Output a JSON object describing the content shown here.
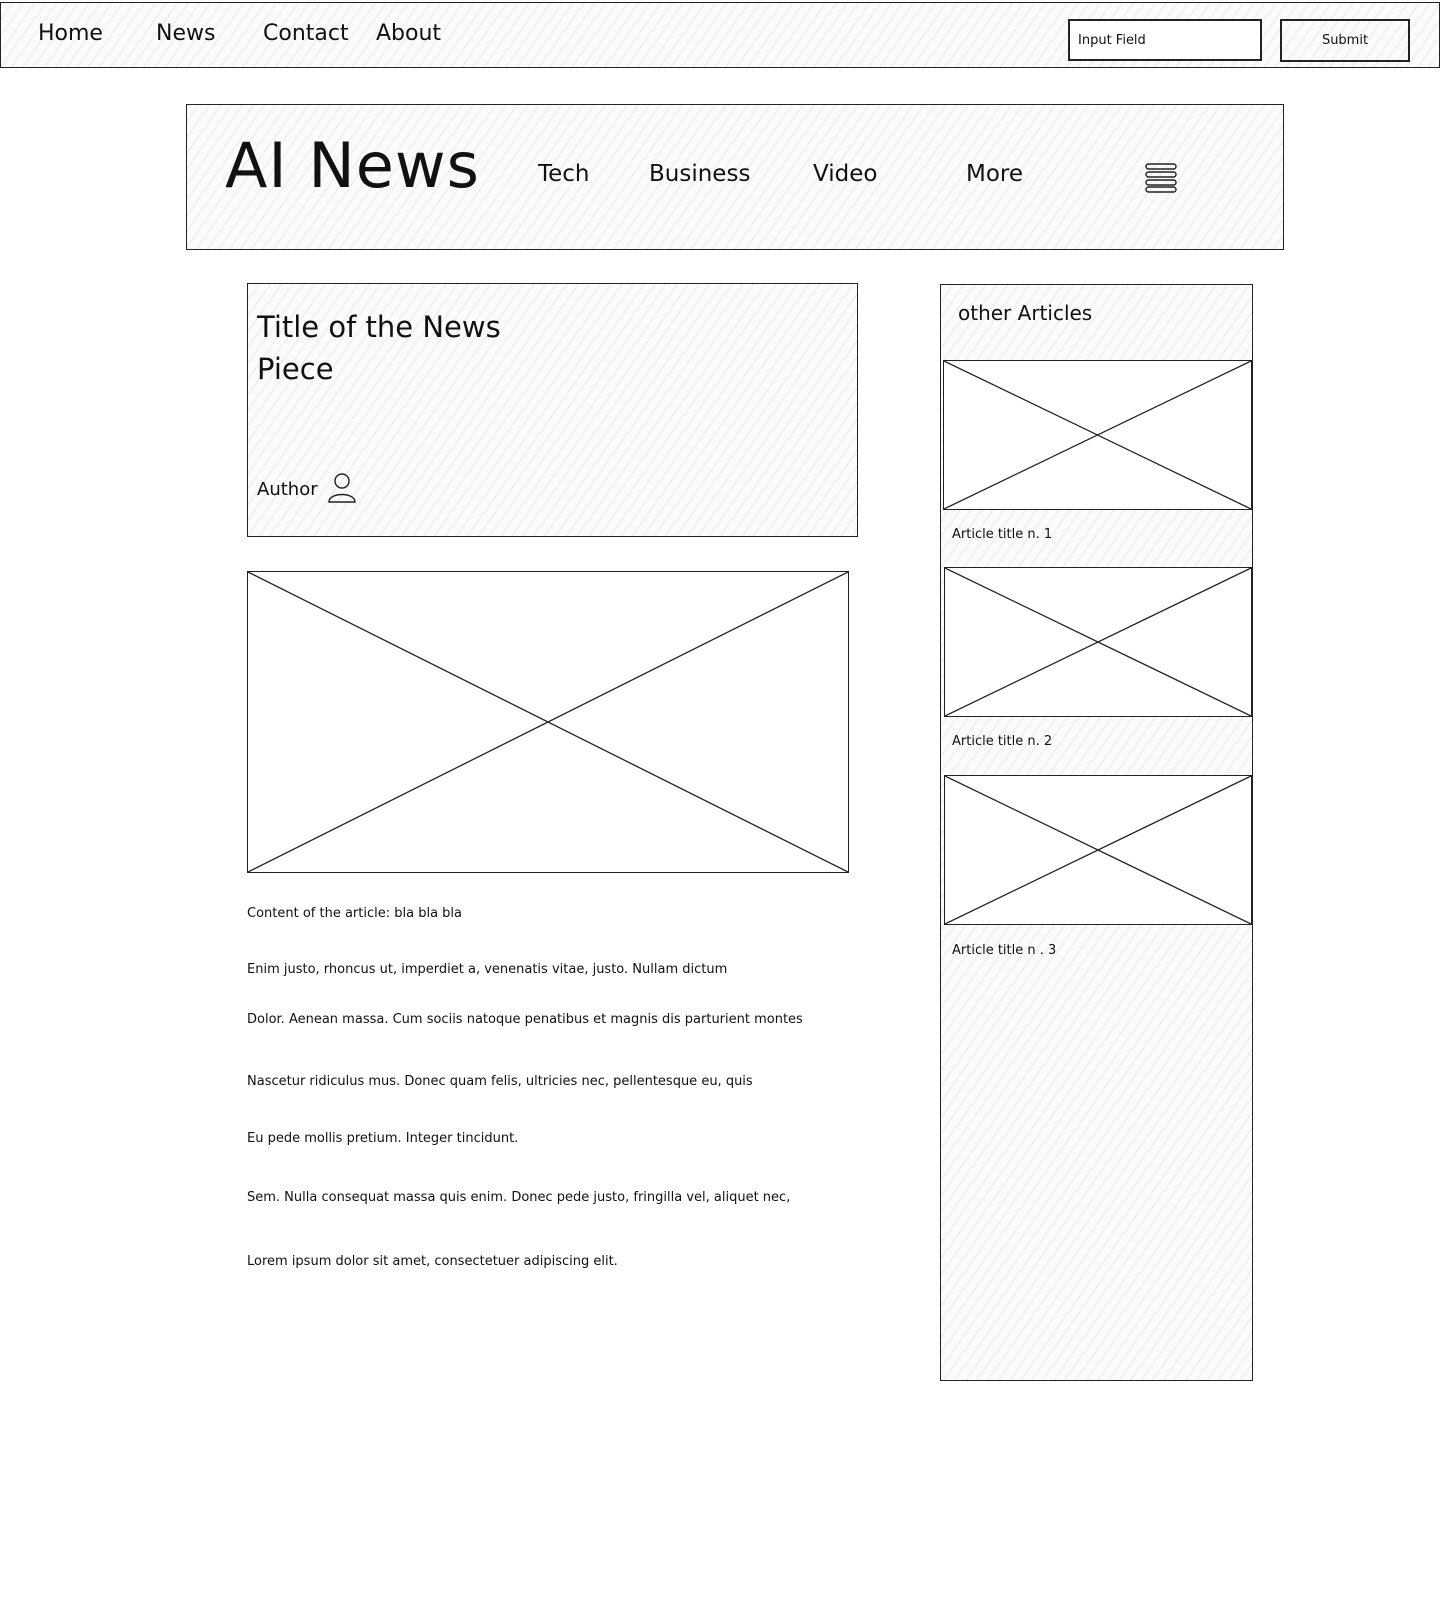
{
  "topnav": {
    "links": [
      "Home",
      "News",
      "Contact",
      "About"
    ],
    "input_value": "Input Field",
    "submit_label": "Submit"
  },
  "header": {
    "logo": "AI News",
    "categories": [
      "Tech",
      "Business",
      "Video",
      "More"
    ],
    "menu_icon": "hamburger-menu-icon"
  },
  "article": {
    "title": "Title of the News Piece",
    "author_label": "Author",
    "author_icon": "user-icon",
    "paragraphs": [
      "Content of the article: bla bla bla",
      "Enim justo, rhoncus ut, imperdiet a, venenatis vitae, justo. Nullam dictum",
      "Dolor. Aenean massa. Cum sociis natoque penatibus et magnis dis parturient montes",
      "Nascetur ridiculus mus. Donec quam felis, ultricies nec, pellentesque eu, quis",
      "Eu pede mollis pretium. Integer tincidunt.",
      "Sem. Nulla consequat massa quis enim. Donec pede justo, fringilla vel, aliquet nec,",
      "Lorem ipsum dolor sit amet, consectetuer adipiscing elit."
    ]
  },
  "sidebar": {
    "title": "other Articles",
    "articles": [
      {
        "title": "Article title n. 1"
      },
      {
        "title": "Article title n. 2"
      },
      {
        "title": "Article title n . 3"
      }
    ]
  }
}
